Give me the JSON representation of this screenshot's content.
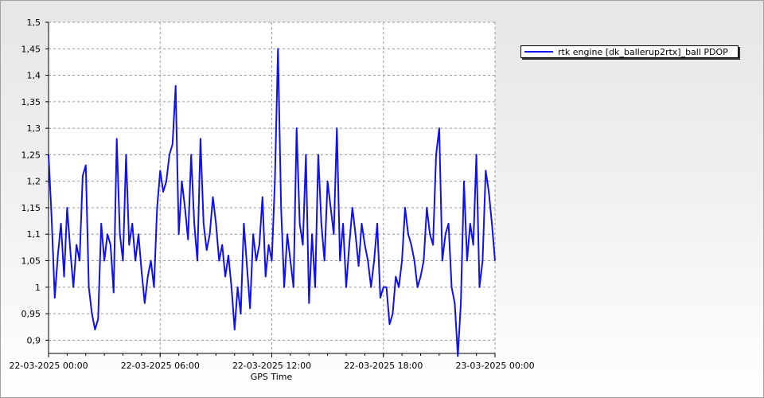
{
  "chart_data": {
    "type": "line",
    "title": "",
    "xlabel": "GPS Time",
    "ylabel": "",
    "x_ticks": [
      "22-03-2025 00:00",
      "22-03-2025 06:00",
      "22-03-2025 12:00",
      "22-03-2025 18:00",
      "23-03-2025 00:00"
    ],
    "y_ticks": [
      "0,9",
      "0,95",
      "1",
      "1,05",
      "1,1",
      "1,15",
      "1,2",
      "1,25",
      "1,3",
      "1,35",
      "1,4",
      "1,45",
      "1,5"
    ],
    "ylim": [
      0.875,
      1.5
    ],
    "xlim": [
      "2025-03-22T00:00",
      "2025-03-23T00:00"
    ],
    "grid": true,
    "legend_position": "top-right",
    "series_color": "#1010f0",
    "series": [
      {
        "name": "rtk engine [dk_ballerup2rtx]_ball PDOP",
        "x": [
          "2025-03-22T00:00",
          "2025-03-22T00:10",
          "2025-03-22T00:20",
          "2025-03-22T00:30",
          "2025-03-22T00:40",
          "2025-03-22T00:50",
          "2025-03-22T01:00",
          "2025-03-22T01:10",
          "2025-03-22T01:20",
          "2025-03-22T01:30",
          "2025-03-22T01:40",
          "2025-03-22T01:50",
          "2025-03-22T02:00",
          "2025-03-22T02:10",
          "2025-03-22T02:20",
          "2025-03-22T02:30",
          "2025-03-22T02:40",
          "2025-03-22T02:50",
          "2025-03-22T03:00",
          "2025-03-22T03:10",
          "2025-03-22T03:20",
          "2025-03-22T03:30",
          "2025-03-22T03:40",
          "2025-03-22T03:50",
          "2025-03-22T04:00",
          "2025-03-22T04:10",
          "2025-03-22T04:20",
          "2025-03-22T04:30",
          "2025-03-22T04:40",
          "2025-03-22T04:50",
          "2025-03-22T05:00",
          "2025-03-22T05:10",
          "2025-03-22T05:20",
          "2025-03-22T05:30",
          "2025-03-22T05:40",
          "2025-03-22T05:50",
          "2025-03-22T06:00",
          "2025-03-22T06:10",
          "2025-03-22T06:20",
          "2025-03-22T06:30",
          "2025-03-22T06:40",
          "2025-03-22T06:50",
          "2025-03-22T07:00",
          "2025-03-22T07:10",
          "2025-03-22T07:20",
          "2025-03-22T07:30",
          "2025-03-22T07:40",
          "2025-03-22T07:50",
          "2025-03-22T08:00",
          "2025-03-22T08:10",
          "2025-03-22T08:20",
          "2025-03-22T08:30",
          "2025-03-22T08:40",
          "2025-03-22T08:50",
          "2025-03-22T09:00",
          "2025-03-22T09:10",
          "2025-03-22T09:20",
          "2025-03-22T09:30",
          "2025-03-22T09:40",
          "2025-03-22T09:50",
          "2025-03-22T10:00",
          "2025-03-22T10:10",
          "2025-03-22T10:20",
          "2025-03-22T10:30",
          "2025-03-22T10:40",
          "2025-03-22T10:50",
          "2025-03-22T11:00",
          "2025-03-22T11:10",
          "2025-03-22T11:20",
          "2025-03-22T11:30",
          "2025-03-22T11:40",
          "2025-03-22T11:50",
          "2025-03-22T12:00",
          "2025-03-22T12:10",
          "2025-03-22T12:20",
          "2025-03-22T12:30",
          "2025-03-22T12:40",
          "2025-03-22T12:50",
          "2025-03-22T13:00",
          "2025-03-22T13:10",
          "2025-03-22T13:20",
          "2025-03-22T13:30",
          "2025-03-22T13:40",
          "2025-03-22T13:50",
          "2025-03-22T14:00",
          "2025-03-22T14:10",
          "2025-03-22T14:20",
          "2025-03-22T14:30",
          "2025-03-22T14:40",
          "2025-03-22T14:50",
          "2025-03-22T15:00",
          "2025-03-22T15:10",
          "2025-03-22T15:20",
          "2025-03-22T15:30",
          "2025-03-22T15:40",
          "2025-03-22T15:50",
          "2025-03-22T16:00",
          "2025-03-22T16:10",
          "2025-03-22T16:20",
          "2025-03-22T16:30",
          "2025-03-22T16:40",
          "2025-03-22T16:50",
          "2025-03-22T17:00",
          "2025-03-22T17:10",
          "2025-03-22T17:20",
          "2025-03-22T17:30",
          "2025-03-22T17:40",
          "2025-03-22T17:50",
          "2025-03-22T18:00",
          "2025-03-22T18:10",
          "2025-03-22T18:20",
          "2025-03-22T18:30",
          "2025-03-22T18:40",
          "2025-03-22T18:50",
          "2025-03-22T19:00",
          "2025-03-22T19:10",
          "2025-03-22T19:20",
          "2025-03-22T19:30",
          "2025-03-22T19:40",
          "2025-03-22T19:50",
          "2025-03-22T20:00",
          "2025-03-22T20:10",
          "2025-03-22T20:20",
          "2025-03-22T20:30",
          "2025-03-22T20:40",
          "2025-03-22T20:50",
          "2025-03-22T21:00",
          "2025-03-22T21:10",
          "2025-03-22T21:20",
          "2025-03-22T21:30",
          "2025-03-22T21:40",
          "2025-03-22T21:50",
          "2025-03-22T22:00",
          "2025-03-22T22:10",
          "2025-03-22T22:20",
          "2025-03-22T22:30",
          "2025-03-22T22:40",
          "2025-03-22T22:50",
          "2025-03-22T23:00",
          "2025-03-22T23:10",
          "2025-03-22T23:20",
          "2025-03-22T23:30",
          "2025-03-22T23:40",
          "2025-03-22T23:50",
          "2025-03-23T00:00"
        ],
        "y": [
          1.25,
          1.13,
          0.98,
          1.06,
          1.12,
          1.02,
          1.15,
          1.07,
          1.0,
          1.08,
          1.05,
          1.21,
          1.23,
          1.0,
          0.95,
          0.92,
          0.94,
          1.12,
          1.05,
          1.1,
          1.08,
          0.99,
          1.28,
          1.1,
          1.05,
          1.25,
          1.08,
          1.12,
          1.05,
          1.1,
          1.03,
          0.97,
          1.02,
          1.05,
          1.0,
          1.15,
          1.22,
          1.18,
          1.2,
          1.25,
          1.27,
          1.38,
          1.1,
          1.2,
          1.15,
          1.09,
          1.25,
          1.12,
          1.05,
          1.28,
          1.12,
          1.07,
          1.1,
          1.17,
          1.12,
          1.05,
          1.08,
          1.02,
          1.06,
          1.0,
          0.92,
          1.0,
          0.95,
          1.12,
          1.04,
          0.96,
          1.1,
          1.05,
          1.08,
          1.17,
          1.02,
          1.08,
          1.05,
          1.2,
          1.45,
          1.15,
          1.0,
          1.1,
          1.05,
          1.0,
          1.3,
          1.12,
          1.08,
          1.25,
          0.97,
          1.1,
          1.0,
          1.25,
          1.12,
          1.05,
          1.2,
          1.15,
          1.1,
          1.3,
          1.05,
          1.12,
          1.0,
          1.08,
          1.15,
          1.1,
          1.04,
          1.12,
          1.08,
          1.05,
          1.0,
          1.05,
          1.12,
          0.98,
          1.0,
          1.0,
          0.93,
          0.95,
          1.02,
          1.0,
          1.05,
          1.15,
          1.1,
          1.08,
          1.05,
          1.0,
          1.02,
          1.05,
          1.15,
          1.1,
          1.08,
          1.25,
          1.3,
          1.05,
          1.1,
          1.12,
          1.0,
          0.97,
          0.87,
          0.97,
          1.2,
          1.05,
          1.12,
          1.08,
          1.25,
          1.0,
          1.05,
          1.22,
          1.18,
          1.12,
          1.05
        ]
      }
    ]
  }
}
